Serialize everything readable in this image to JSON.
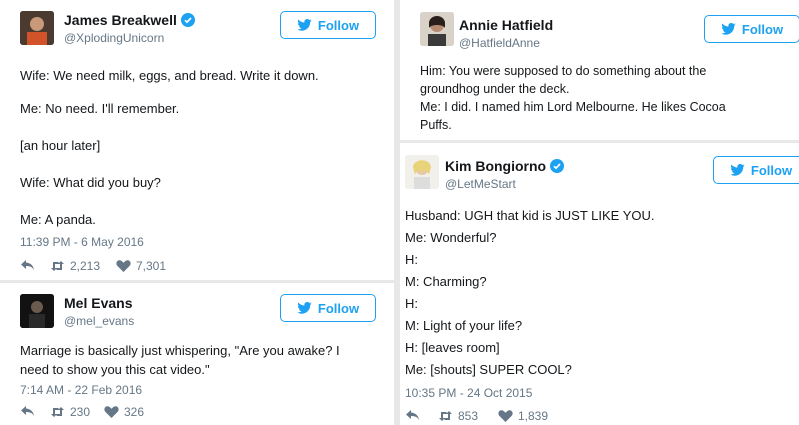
{
  "colors": {
    "accent": "#1da1f2",
    "muted": "#657786",
    "text": "#14171a"
  },
  "tweets": [
    {
      "name": "James Breakwell",
      "handle": "@XplodingUnicorn",
      "verified": true,
      "follow_label": "Follow",
      "lines": [
        "Wife: We need milk, eggs, and bread. Write it down.",
        "Me: No need. I'll remember.",
        "[an hour later]",
        "Wife: What did you buy?",
        "Me: A panda."
      ],
      "timestamp": "11:39 PM - 6 May 2016",
      "retweets": "2,213",
      "likes": "7,301"
    },
    {
      "name": "Mel Evans",
      "handle": "@mel_evans",
      "verified": false,
      "follow_label": "Follow",
      "lines": [
        "Marriage is basically just whispering, \"Are you awake? I",
        "need to show you this cat video.\""
      ],
      "timestamp": "7:14 AM - 22 Feb 2016",
      "retweets": "230",
      "likes": "326"
    },
    {
      "name": "Annie Hatfield",
      "handle": "@HatfieldAnne",
      "verified": false,
      "follow_label": "Follow",
      "lines": [
        "Him: You were supposed to do something about the",
        "groundhog under the deck.",
        "Me: I did. I named him Lord Melbourne. He likes Cocoa",
        "Puffs."
      ]
    },
    {
      "name": "Kim Bongiorno",
      "handle": "@LetMeStart",
      "verified": true,
      "follow_label": "Follow",
      "lines": [
        "Husband: UGH that kid is JUST LIKE YOU.",
        "Me: Wonderful?",
        "H:",
        "M: Charming?",
        "H:",
        "M: Light of your life?",
        "H: [leaves room]",
        "Me: [shouts] SUPER COOL?"
      ],
      "timestamp": "10:35 PM - 24 Oct 2015",
      "retweets": "853",
      "likes": "1,839"
    }
  ]
}
